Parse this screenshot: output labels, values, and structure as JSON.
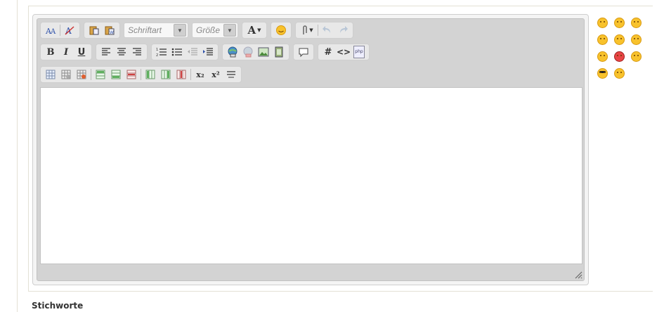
{
  "editor": {
    "font_placeholder": "Schriftart",
    "size_placeholder": "Größe",
    "format_labels": {
      "bold": "B",
      "italic": "I",
      "underline": "U",
      "text_color": "A",
      "hash": "#",
      "code": "<>",
      "php": "php",
      "subscript": "x₂",
      "superscript": "x²"
    }
  },
  "smileys": [
    "smiley-tongue",
    "smiley-grin",
    "smiley-laugh",
    "smiley-wink",
    "smiley-smile",
    "smiley-sad",
    "smiley-confused",
    "smiley-angry",
    "smiley-happy",
    "smiley-cool",
    "smiley-surprised"
  ],
  "form": {
    "keywords_label": "Stichworte"
  }
}
